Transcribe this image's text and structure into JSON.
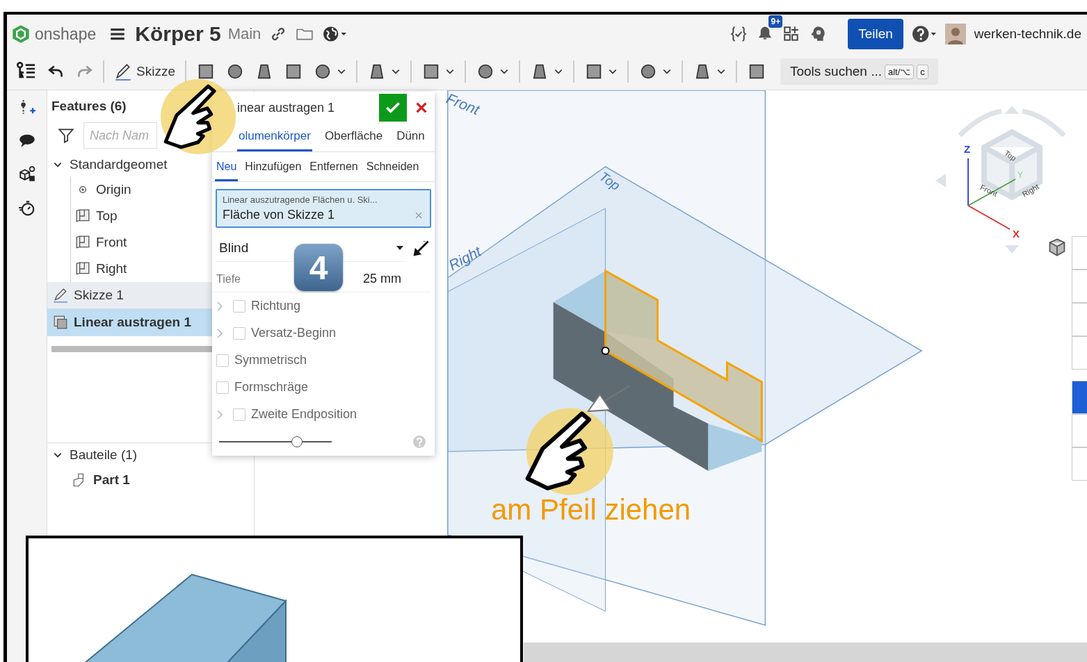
{
  "header": {
    "logo": "onshape",
    "title": "Körper 5",
    "branch": "Main",
    "notifications": "9+",
    "share": "Teilen",
    "user": "werken-technik.de"
  },
  "toolbar": {
    "sketch": "Skizze",
    "search": "Tools suchen ...",
    "keys": [
      "alt/⌥",
      "c"
    ]
  },
  "features": {
    "title": "Features (6)",
    "filter_placeholder": "Nach Nam",
    "tree": {
      "label": "Standardgeomet",
      "expanded": true,
      "children": [
        {
          "label": "Origin",
          "kind": "point"
        },
        {
          "label": "Top",
          "kind": "plane"
        },
        {
          "label": "Front",
          "kind": "plane"
        },
        {
          "label": "Right",
          "kind": "plane"
        }
      ]
    },
    "items": [
      {
        "label": "Skizze 1",
        "kind": "sketch",
        "selected": false
      },
      {
        "label": "Linear austragen 1",
        "kind": "extrude",
        "selected": true
      }
    ],
    "parts": {
      "label": "Bauteile (1)",
      "expanded": true,
      "children": [
        {
          "label": "Part 1"
        }
      ]
    }
  },
  "dialog": {
    "title": "inear austragen 1",
    "body_tabs": [
      {
        "label": "olumenkörper",
        "selected": true
      },
      {
        "label": "Oberfläche",
        "selected": false
      },
      {
        "label": "Dünn",
        "selected": false
      }
    ],
    "op_tabs": [
      {
        "label": "Neu",
        "selected": true
      },
      {
        "label": "Hinzufügen",
        "selected": false
      },
      {
        "label": "Entfernen",
        "selected": false
      },
      {
        "label": "Schneiden",
        "selected": false
      }
    ],
    "selection": {
      "label": "Linear auszutragende Flächen u. Ski...",
      "value": "Fläche von Skizze 1"
    },
    "end_type": "Blind",
    "depth_label": "Tiefe",
    "depth": "25 mm",
    "options": [
      {
        "label": "Richtung",
        "checked": false,
        "expandable": true
      },
      {
        "label": "Versatz-Beginn",
        "checked": false,
        "expandable": true
      },
      {
        "label": "Symmetrisch",
        "checked": false,
        "expandable": false
      },
      {
        "label": "Formschräge",
        "checked": false,
        "expandable": false
      },
      {
        "label": "Zweite Endposition",
        "checked": false,
        "expandable": true
      }
    ],
    "slider": {
      "level": 0.69
    }
  },
  "viewport": {
    "planes": [
      "Front",
      "Top",
      "Right"
    ],
    "cube": {
      "top": "Top",
      "front": "Front",
      "right": "Right",
      "axes": [
        "Z",
        "Y",
        "X"
      ]
    }
  },
  "annotation": {
    "step": "4",
    "hint": "am Pfeil ziehen"
  }
}
